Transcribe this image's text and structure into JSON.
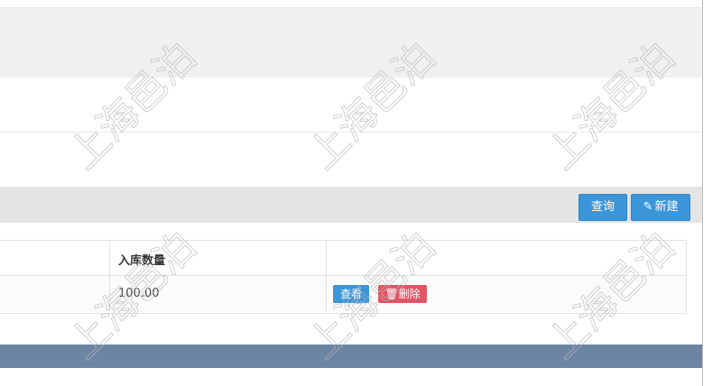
{
  "toolbar": {
    "query_label": "查询",
    "new_label": "新建",
    "new_icon": "pencil-icon"
  },
  "table": {
    "columns": [
      "入库数量"
    ],
    "rows": [
      {
        "quantity": "100.00",
        "actions": {
          "view_label": "查看",
          "delete_label": "删除",
          "delete_icon": "trash-icon"
        }
      }
    ]
  },
  "watermark": {
    "text": "上海邑泊"
  },
  "colors": {
    "primary": "#3a95d9",
    "danger": "#e05563",
    "footer": "#6b85a3",
    "toolbar_bg": "#e4e4e4"
  }
}
